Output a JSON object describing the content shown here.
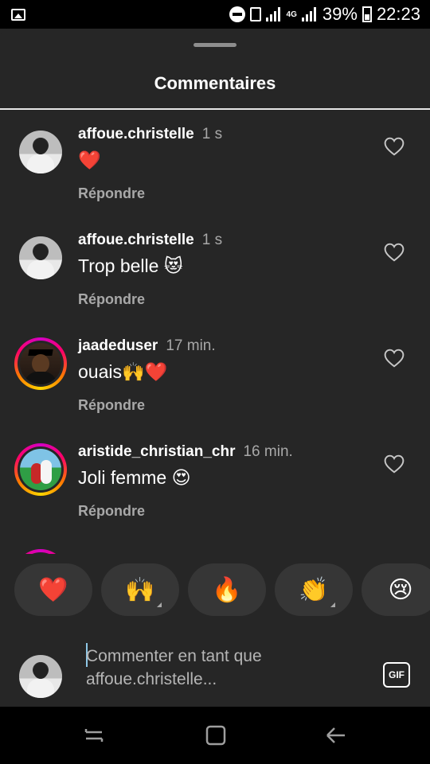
{
  "status_bar": {
    "battery": "39%",
    "time": "22:23",
    "network": "4G"
  },
  "sheet": {
    "title": "Commentaires"
  },
  "comments": [
    {
      "user": "affoue.christelle",
      "time": "1 s",
      "text": "❤️",
      "reply": "Répondre",
      "avatar": "grey-portrait"
    },
    {
      "user": "affoue.christelle",
      "time": "1 s",
      "text": "Trop belle 😻",
      "reply": "Répondre",
      "avatar": "grey-portrait"
    },
    {
      "user": "jaadeduser",
      "time": "17 min.",
      "text": "ouais🙌❤️",
      "reply": "Répondre",
      "avatar": "graduate-portrait"
    },
    {
      "user": "aristide_christian_chr",
      "time": "16 min.",
      "text": "Joli femme 😍",
      "reply": "Répondre",
      "avatar": "couple-photo"
    }
  ],
  "emoji_bar": [
    "❤️",
    "🙌",
    "🔥",
    "👏",
    "😢"
  ],
  "composer": {
    "placeholder": "Commenter en tant que\naffoue.christelle...",
    "gif_label": "GIF"
  },
  "colors": {
    "background": "#262626",
    "muted_text": "#a8a8a8",
    "story_ring": "#ff0069"
  }
}
